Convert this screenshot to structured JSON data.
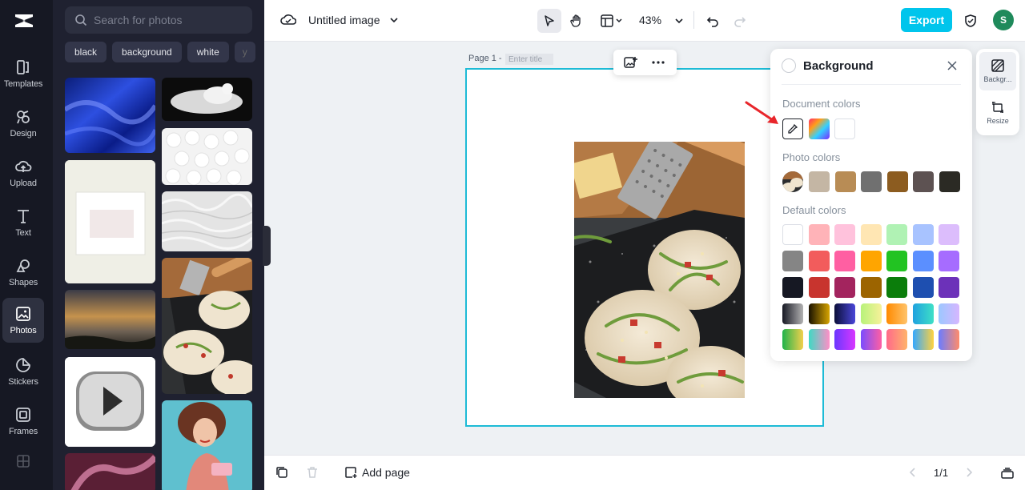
{
  "sidebar": {
    "items": [
      {
        "label": "Templates",
        "icon": "templates-icon"
      },
      {
        "label": "Design",
        "icon": "design-icon"
      },
      {
        "label": "Upload",
        "icon": "upload-icon"
      },
      {
        "label": "Text",
        "icon": "text-icon"
      },
      {
        "label": "Shapes",
        "icon": "shapes-icon"
      },
      {
        "label": "Photos",
        "icon": "photos-icon",
        "active": true
      },
      {
        "label": "Stickers",
        "icon": "stickers-icon"
      },
      {
        "label": "Frames",
        "icon": "frames-icon"
      }
    ]
  },
  "photos_panel": {
    "search_placeholder": "Search for photos",
    "chips": [
      "black",
      "background",
      "white",
      "y"
    ]
  },
  "header": {
    "title": "Untitled image",
    "zoom": "43%",
    "export_label": "Export",
    "avatar_initial": "S"
  },
  "canvas": {
    "page_label": "Page 1 -",
    "title_placeholder": "Enter title"
  },
  "bottom": {
    "add_page_label": "Add page",
    "page_indicator": "1/1"
  },
  "background_panel": {
    "title": "Background",
    "document_colors_label": "Document colors",
    "photo_colors_label": "Photo colors",
    "default_colors_label": "Default colors",
    "photo_colors": [
      "#c4b6a4",
      "#b88c55",
      "#707070",
      "#8c5c20",
      "#5d5252",
      "#2b2a24"
    ],
    "default_colors": [
      [
        "#ffffff",
        "#ffb3b8",
        "#ffc2dc",
        "#ffe6b3",
        "#b0f2b4",
        "#a8c3ff",
        "#dcbdfc"
      ],
      [
        "#858585",
        "#f25c5c",
        "#ff5fa2",
        "#ffa500",
        "#22c322",
        "#5b8fff",
        "#a66cff"
      ],
      [
        "#161823",
        "#c8342e",
        "#a3245e",
        "#9c6400",
        "#0b7d0b",
        "#1e4fb0",
        "#6c31b9"
      ]
    ]
  },
  "right_rail": {
    "background_label": "Backgr...",
    "resize_label": "Resize"
  }
}
